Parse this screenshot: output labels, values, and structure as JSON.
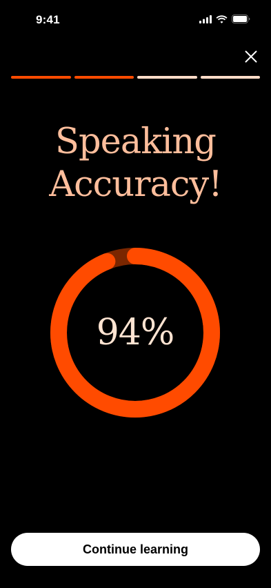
{
  "status_bar": {
    "time": "9:41",
    "icons": [
      "signal-icon",
      "wifi-icon",
      "battery-icon"
    ]
  },
  "header": {
    "close_icon": "close-icon",
    "progress_segments_total": 4,
    "progress_segments_completed": 2
  },
  "result": {
    "title_line1": "Speaking",
    "title_line2": "Accuracy!",
    "score_text": "94%",
    "score_fraction": 0.94
  },
  "footer": {
    "continue_label": "Continue learning"
  },
  "colors": {
    "background": "#000000",
    "accent": "#FF4B00",
    "accent_dim": "#7A2600",
    "title": "#FFBE9C",
    "score_text": "#FFE4D2",
    "segment_inactive": "#FFDCC8",
    "button_bg": "#FFFFFF",
    "button_text": "#000000"
  }
}
